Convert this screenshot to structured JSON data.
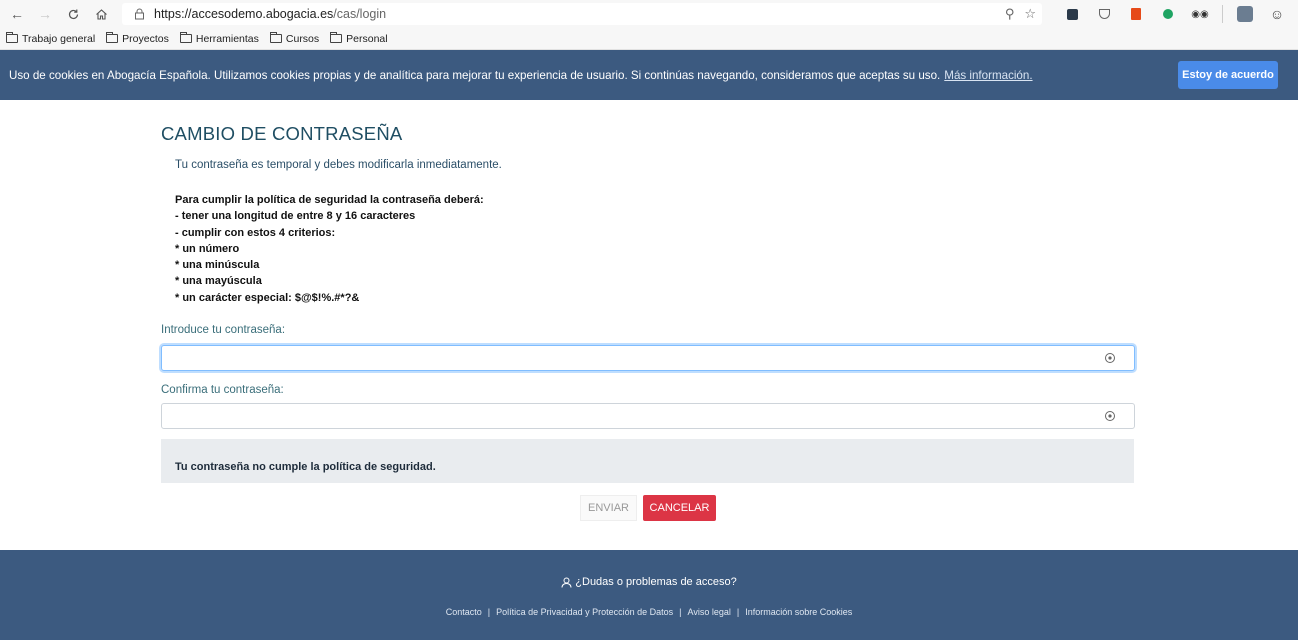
{
  "browser": {
    "url_host": "https://accesodemo.abogacia.es",
    "url_path": "/cas/login",
    "bookmarks": [
      "Trabajo general",
      "Proyectos",
      "Herramientas",
      "Cursos",
      "Personal"
    ]
  },
  "cookie_banner": {
    "text": "Uso de cookies en Abogacía Española. Utilizamos cookies propias y de analítica para mejorar tu experiencia de usuario. Si continúas navegando, consideramos que aceptas su uso.",
    "more_link": "Más información.",
    "accept_button": "Estoy de acuerdo"
  },
  "page": {
    "title": "CAMBIO DE CONTRASEÑA",
    "notice": "Tu contraseña es temporal y debes modificarla inmediatamente.",
    "policy_lines": [
      "Para cumplir la política de seguridad la contraseña deberá:",
      "- tener una longitud de entre 8 y 16 caracteres",
      "- cumplir con estos 4 criterios:",
      "* un número",
      "* una minúscula",
      "* una mayúscula",
      "* un carácter especial: $@$!%.#*?&"
    ],
    "password_label": "Introduce tu contraseña:",
    "password_value": "",
    "confirm_label": "Confirma tu contraseña:",
    "confirm_value": "",
    "alert": "Tu contraseña no cumple la política de seguridad.",
    "send_button": "ENVIAR",
    "cancel_button": "CANCELAR"
  },
  "footer": {
    "help": "¿Dudas o problemas de acceso?",
    "links": [
      "Contacto",
      "Política de Privacidad y Protección de Datos",
      "Aviso legal",
      "Información sobre Cookies"
    ]
  },
  "colors": {
    "banner": "#3c5a80",
    "accept": "#4a8be8",
    "cancel": "#dc3545",
    "title": "#1f4e63"
  }
}
